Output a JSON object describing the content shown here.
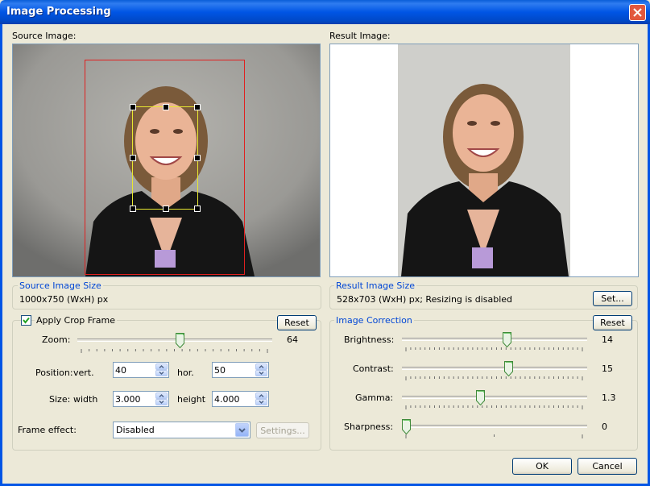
{
  "window": {
    "title": "Image Processing"
  },
  "source": {
    "label": "Source Image:"
  },
  "result": {
    "label": "Result Image:"
  },
  "source_size": {
    "title": "Source Image Size",
    "value": "1000x750 (WxH) px"
  },
  "result_size": {
    "title": "Result Image Size",
    "value": "528x703 (WxH) px; Resizing is disabled",
    "set_label": "Set..."
  },
  "crop": {
    "checkbox_label": "Apply Crop Frame",
    "checked": true,
    "reset_label": "Reset",
    "zoom_label": "Zoom:",
    "zoom_value": "64",
    "zoom_fraction": 0.53,
    "position_label": "Position:",
    "vert_label": "vert.",
    "vert_value": "40",
    "hor_label": "hor.",
    "hor_value": "50",
    "size_label": "Size:",
    "width_label": "width",
    "width_value": "3.000",
    "height_label": "height",
    "height_value": "4.000",
    "frame_effect_label": "Frame effect:",
    "frame_effect_value": "Disabled",
    "settings_label": "Settings..."
  },
  "correction": {
    "title": "Image Correction",
    "reset_label": "Reset",
    "brightness_label": "Brightness:",
    "brightness_value": "14",
    "brightness_fraction": 0.57,
    "contrast_label": "Contrast:",
    "contrast_value": "15",
    "contrast_fraction": 0.58,
    "gamma_label": "Gamma:",
    "gamma_value": "1.3",
    "gamma_fraction": 0.42,
    "sharpness_label": "Sharpness:",
    "sharpness_value": "0",
    "sharpness_fraction": 0.0
  },
  "footer": {
    "ok_label": "OK",
    "cancel_label": "Cancel"
  },
  "colors": {
    "title_blue": "#0055e5",
    "group_label": "#0046d5",
    "crop_frame": "#e02020",
    "face_frame": "#e8e830"
  },
  "icons": {
    "close": "close-icon",
    "check": "check-icon",
    "spin_up": "chevron-up-icon",
    "spin_down": "chevron-down-icon",
    "dropdown": "chevron-down-icon"
  }
}
